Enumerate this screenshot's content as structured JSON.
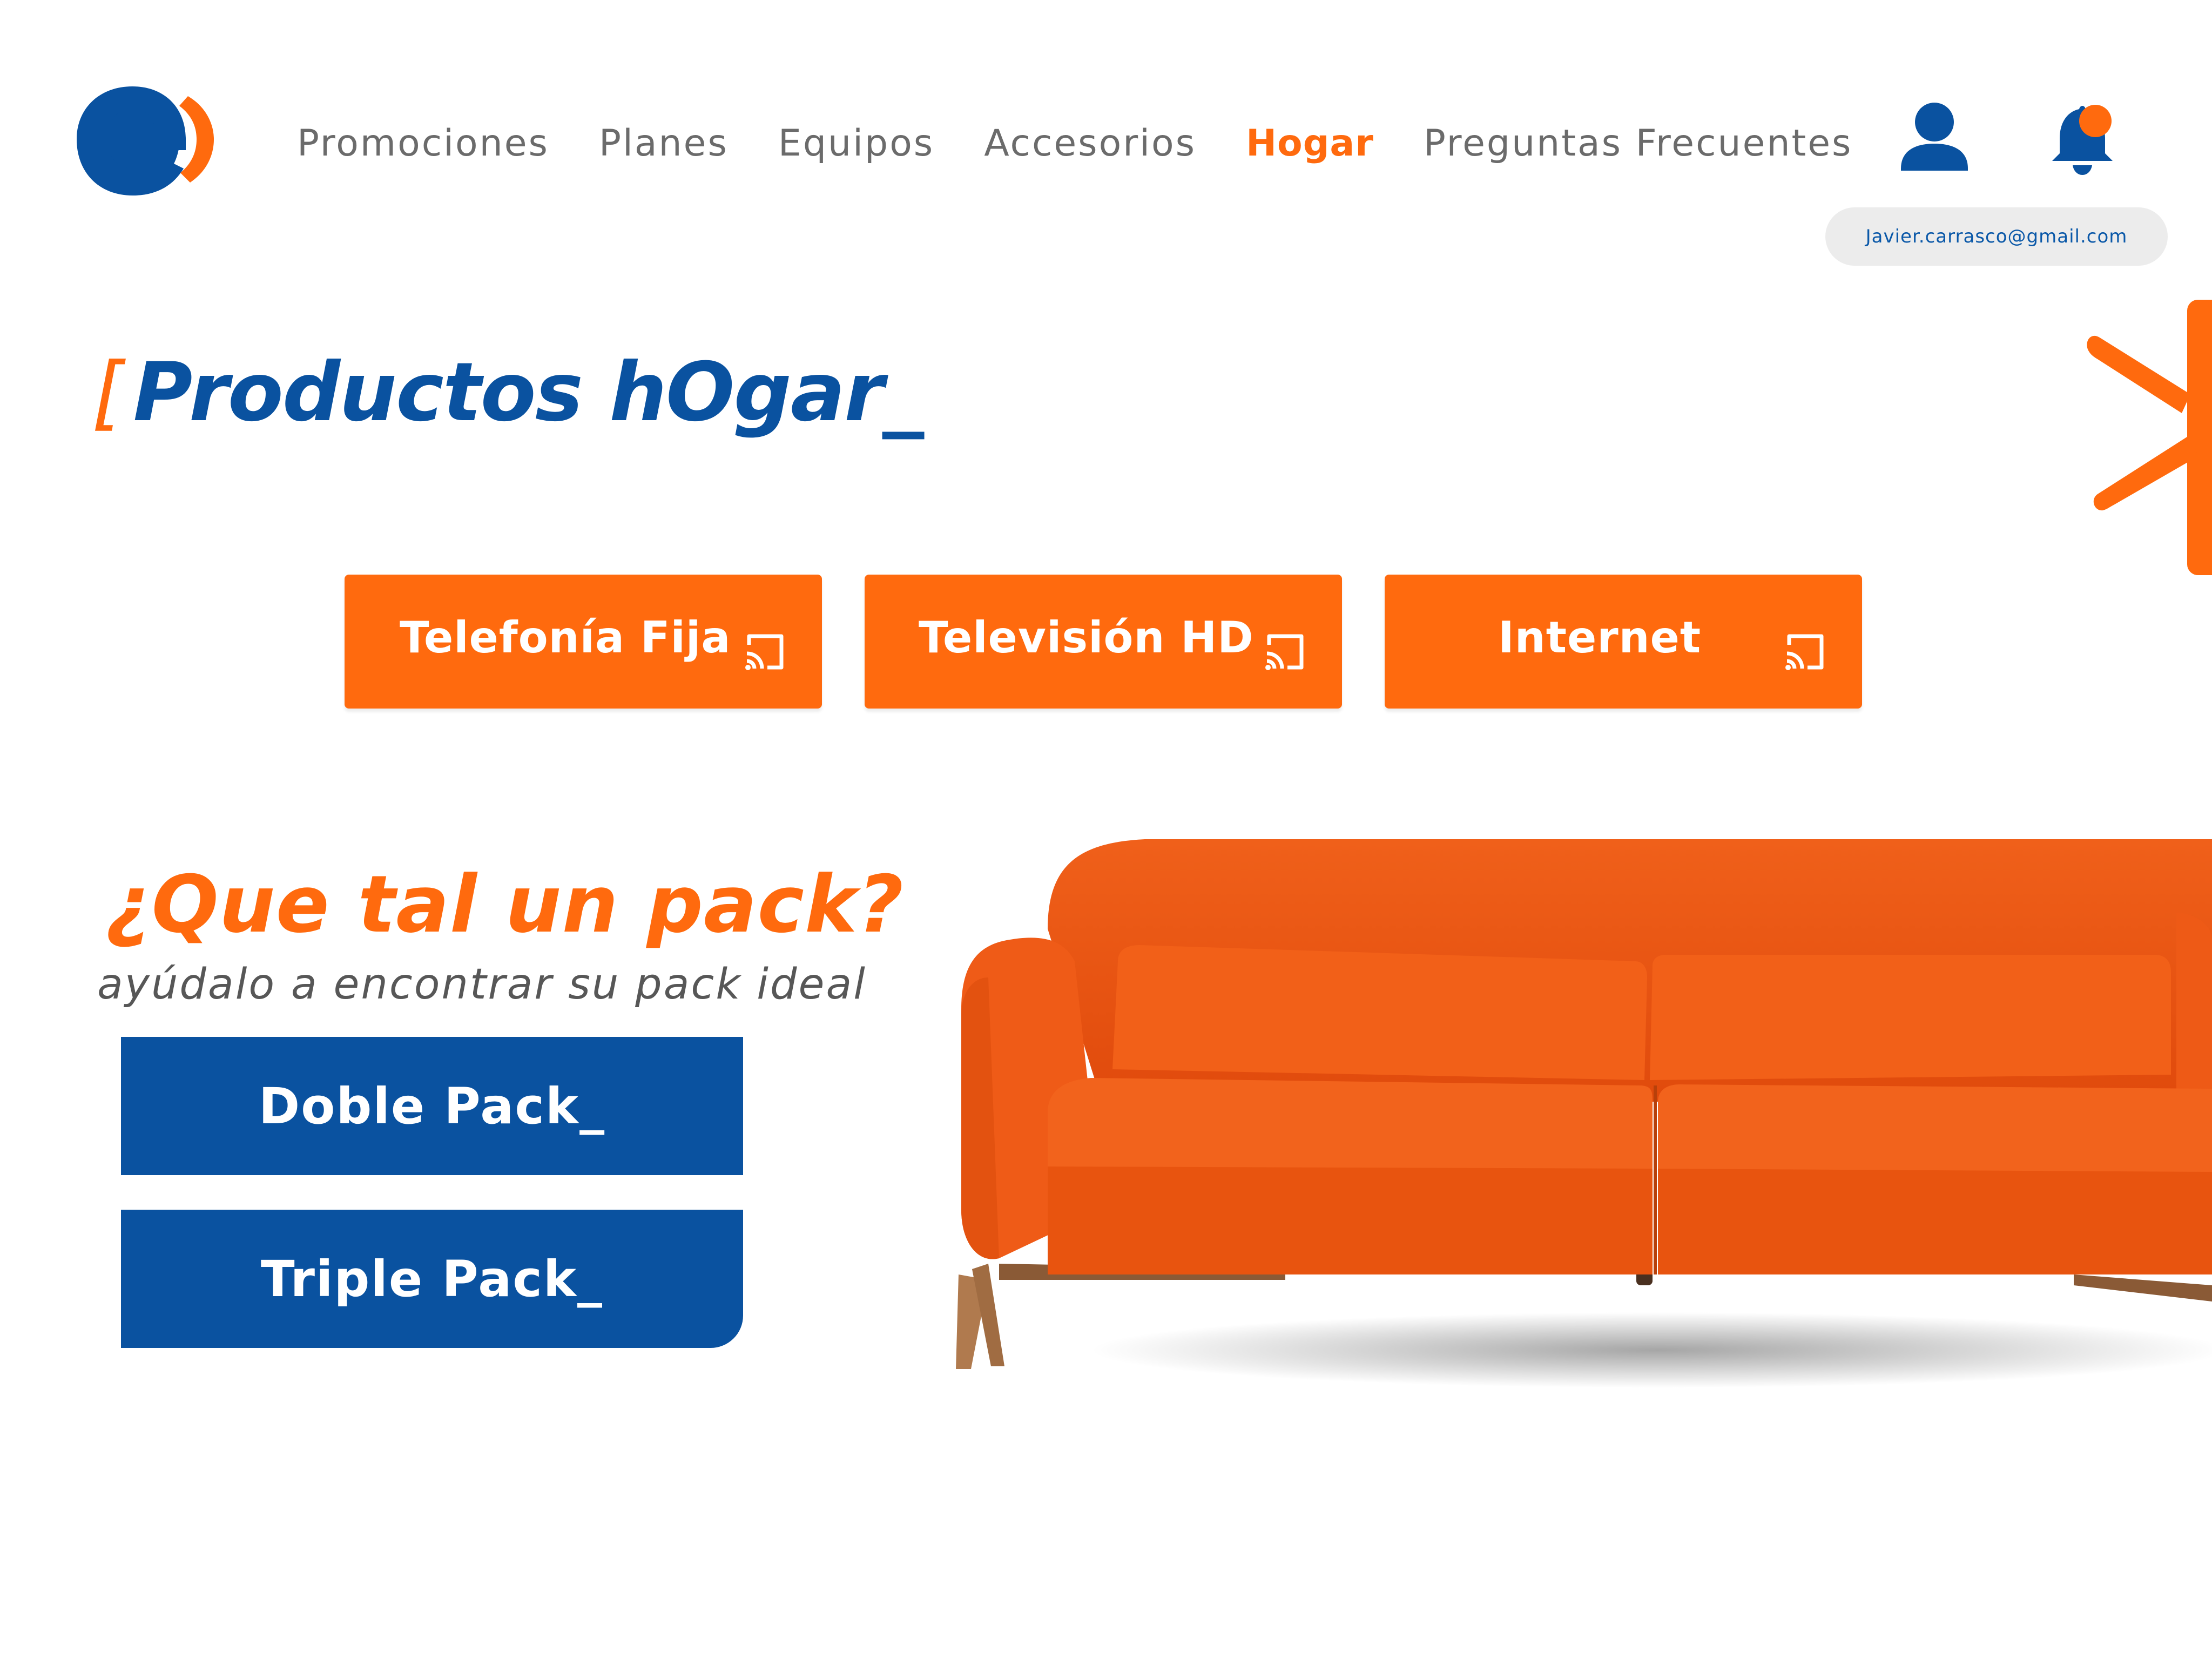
{
  "colors": {
    "brand_blue": "#0a52a0",
    "brand_orange": "#ff6a0e",
    "nav_text": "#6b6b6b",
    "pill_bg": "#ececec"
  },
  "header": {
    "logo_icon": "entel-logo-icon",
    "nav": [
      {
        "label": "Promociones",
        "active": false
      },
      {
        "label": "Planes",
        "active": false
      },
      {
        "label": "Equipos",
        "active": false
      },
      {
        "label": "Accesorios",
        "active": false
      },
      {
        "label": "Hogar",
        "active": true
      },
      {
        "label": "Preguntas Frecuentes",
        "active": false
      }
    ],
    "user_icon": "user-icon",
    "notification_icon": "bell-icon",
    "user_email": "Javier.carrasco@gmail.com"
  },
  "main": {
    "title_bracket": "[",
    "title": "Productos hOgar_",
    "categories": [
      {
        "label": "Telefonía Fija",
        "icon": "cast-icon"
      },
      {
        "label": "Televisión HD",
        "icon": "cast-icon"
      },
      {
        "label": "Internet",
        "icon": "cast-icon"
      }
    ],
    "pack": {
      "heading": "¿Que tal un pack?",
      "subheading": "ayúdalo a encontrar su pack ideal",
      "buttons": [
        "Doble Pack_",
        "Triple Pack_"
      ]
    },
    "decoration_icon": "asterisk-icon",
    "hero_image": "orange-sofa-image"
  }
}
